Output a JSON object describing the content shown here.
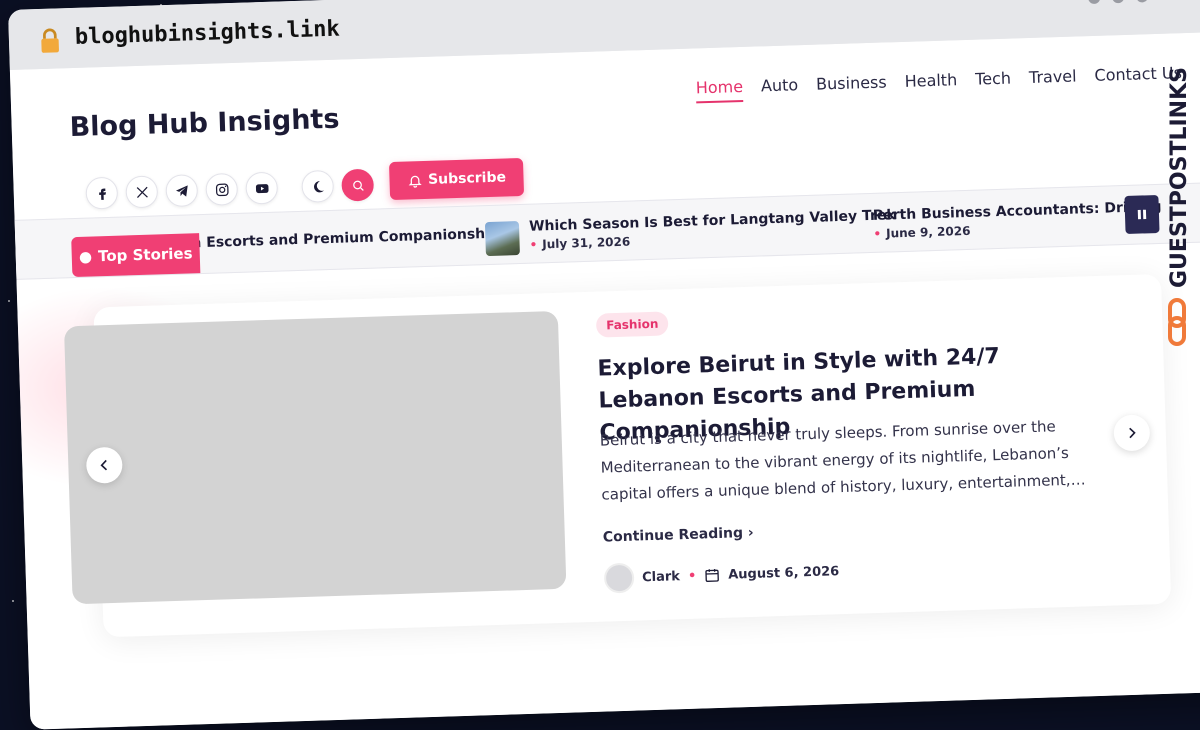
{
  "browser": {
    "url": "bloghubinsights.link"
  },
  "site": {
    "title": "Blog Hub Insights"
  },
  "nav": {
    "items": [
      "Home",
      "Auto",
      "Business",
      "Health",
      "Tech",
      "Travel",
      "Contact Us"
    ],
    "active": "Home"
  },
  "social": [
    "facebook-icon",
    "x-icon",
    "telegram-icon",
    "instagram-icon",
    "youtube-icon",
    "moon-icon",
    "search-icon"
  ],
  "subscribe": {
    "label": "Subscribe"
  },
  "ticker": {
    "label": "Top Stories",
    "items": [
      {
        "title": "n Escorts and Premium Companionship",
        "date": ""
      },
      {
        "title": "Which Season Is Best for Langtang Valley Trek",
        "date": "July 31, 2026"
      },
      {
        "title": "Perth Business Accountants: Driving",
        "date": "June 9, 2026"
      }
    ]
  },
  "featured": {
    "category": "Fashion",
    "title": "Explore Beirut in Style with 24/7 Lebanon Escorts and Premium Companionship",
    "excerpt": "Beirut is a city that never truly sleeps. From sunrise over the Mediterranean to the vibrant energy of its nightlife, Lebanon’s capital offers a unique blend of history, luxury, entertainment,…",
    "cta": "Continue Reading",
    "author": "Clark",
    "date": "August 6, 2026"
  },
  "watermark": {
    "text": "GUESTPOSTLINKS"
  },
  "colors": {
    "accent": "#f03f74",
    "dark": "#1c1b35",
    "background": "#0b1024"
  }
}
